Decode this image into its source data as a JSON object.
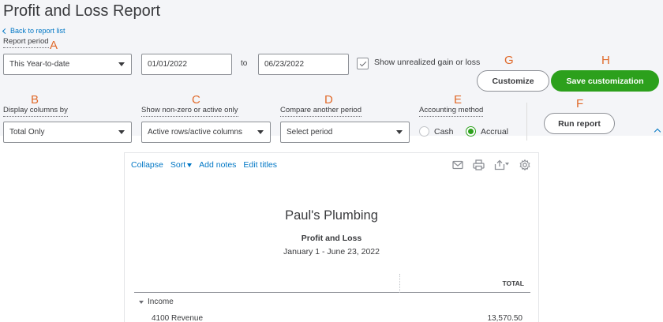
{
  "header": {
    "title": "Profit and Loss Report",
    "back_link": "Back to report list"
  },
  "markers": {
    "a": "A",
    "b": "B",
    "c": "C",
    "d": "D",
    "e": "E",
    "f": "F",
    "g": "G",
    "h": "H"
  },
  "report_period": {
    "label": "Report period",
    "selected": "This Year-to-date",
    "from_date": "01/01/2022",
    "to_label": "to",
    "to_date": "06/23/2022"
  },
  "unrealized": {
    "label": "Show unrealized gain or loss",
    "checked": true
  },
  "buttons": {
    "customize": "Customize",
    "save_customization": "Save customization",
    "run_report": "Run report"
  },
  "display_columns": {
    "label": "Display columns by",
    "selected": "Total Only"
  },
  "non_zero": {
    "label": "Show non-zero or active only",
    "selected": "Active rows/active columns"
  },
  "compare": {
    "label": "Compare another period",
    "selected": "Select period"
  },
  "accounting_method": {
    "label": "Accounting method",
    "options": [
      "Cash",
      "Accrual"
    ],
    "selected": "Accrual"
  },
  "report_toolbar": {
    "collapse": "Collapse",
    "sort": "Sort",
    "add_notes": "Add notes",
    "edit_titles": "Edit titles",
    "icons": [
      "email-icon",
      "print-icon",
      "export-icon",
      "settings-icon"
    ]
  },
  "report": {
    "company": "Paul's Plumbing",
    "title": "Profit and Loss",
    "date_range": "January 1 - June 23, 2022",
    "column_header": "TOTAL",
    "sections": [
      {
        "label": "Income",
        "rows": [
          {
            "label": "4100 Revenue",
            "value": "13,570.50"
          }
        ]
      }
    ]
  },
  "colors": {
    "accent_green": "#2ca01c",
    "link_blue": "#0077c5",
    "marker_orange": "#e06a2b",
    "panel_bg": "#f4f5f8"
  }
}
